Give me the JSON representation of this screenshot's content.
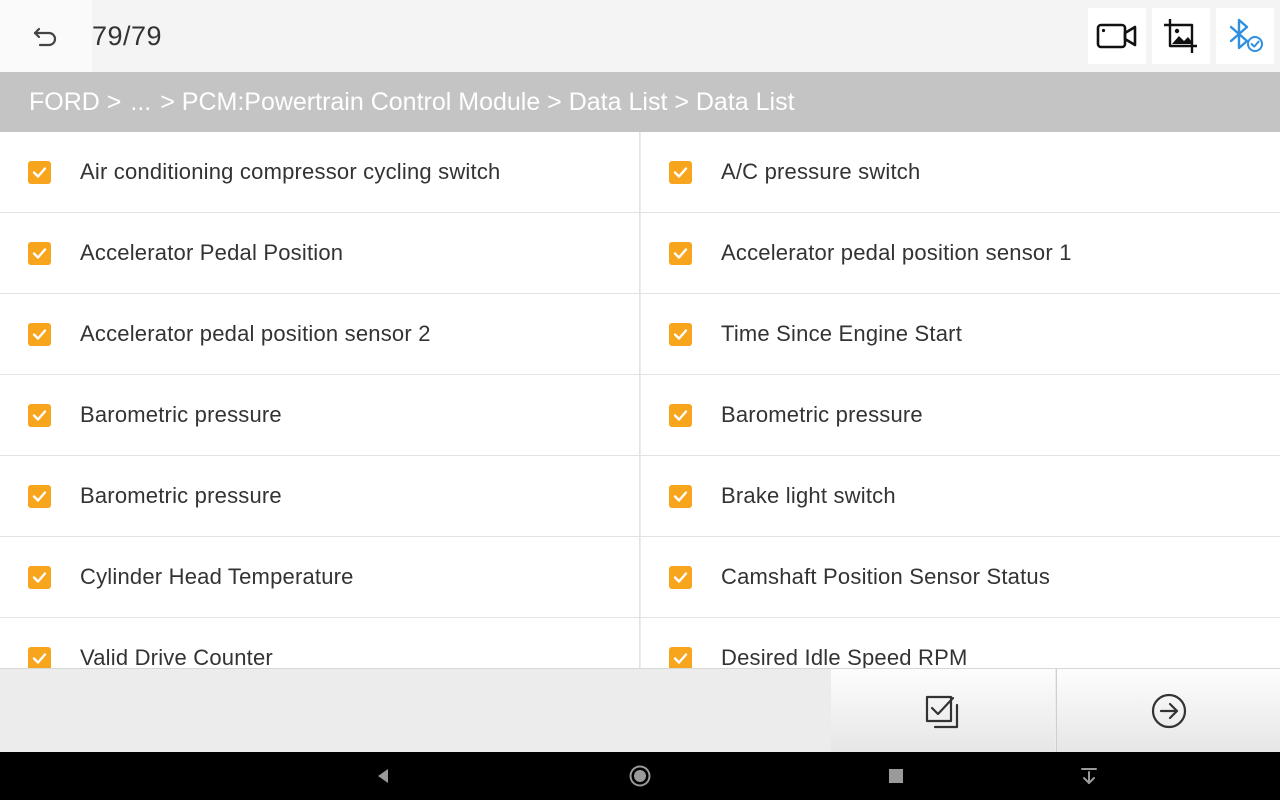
{
  "header": {
    "counter": "79/79"
  },
  "breadcrumb": [
    "FORD >",
    "...",
    "> PCM:Powertrain Control Module > Data List > Data List"
  ],
  "items": [
    [
      "Air conditioning compressor cycling switch",
      "A/C pressure switch"
    ],
    [
      "Accelerator Pedal Position",
      "Accelerator pedal position sensor 1"
    ],
    [
      "Accelerator pedal position sensor 2",
      "Time Since Engine Start"
    ],
    [
      "Barometric pressure",
      "Barometric pressure"
    ],
    [
      "Barometric pressure",
      "Brake light switch"
    ],
    [
      "Cylinder Head Temperature",
      "Camshaft Position Sensor Status"
    ],
    [
      "Valid Drive Counter",
      "Desired Idle Speed RPM"
    ]
  ],
  "colors": {
    "checkbox": "#f7a51d",
    "breadcrumb_bg": "#c4c4c4",
    "bluetooth": "#2f8fe0"
  },
  "icons": {
    "back": "back-arrow-icon",
    "record": "video-camera-icon",
    "screenshot": "image-crop-icon",
    "bluetooth": "bluetooth-connected-icon",
    "select_all": "check-square-icon",
    "next": "arrow-right-circle-icon"
  }
}
